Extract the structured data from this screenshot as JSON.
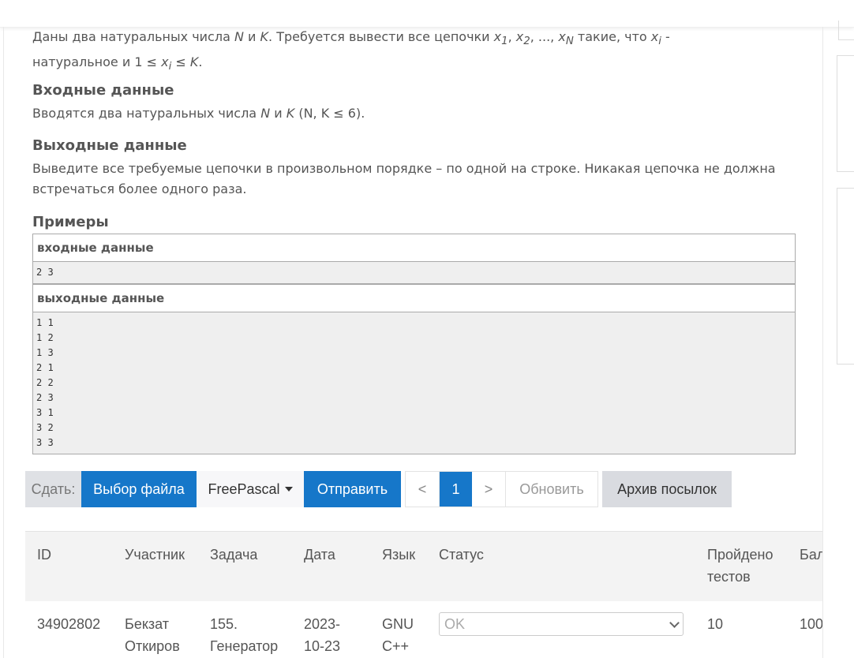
{
  "statement": {
    "line1_part1": "Даны два натуральных числа",
    "N": "N",
    "and": "и",
    "K": "K",
    "line1_part2": ". Требуется вывести  все цепочки",
    "chain": "x",
    "sub1": "1",
    "sub2": "2",
    "dots": "...,",
    "subN": "N",
    "line1_part3": "такие, что",
    "subi": "i",
    "dash": "-",
    "line2": "натуральное и 1 ≤",
    "leq": "≤"
  },
  "input_section": {
    "heading": "Входные данные",
    "text_part1": "Вводятся два натуральных числа",
    "text_part2": "(N, K ≤ 6)."
  },
  "output_section": {
    "heading": "Выходные данные",
    "text": "Выведите все требуемые цепочки в произвольном порядке – по одной на строке. Никакая цепочка не должна встречаться более одного раза."
  },
  "examples": {
    "heading": "Примеры",
    "input_title": "входные данные",
    "input_text": "2 3",
    "output_title": "выходные данные",
    "output_text": "1 1\n1 2\n1 3\n2 1\n2 2\n2 3\n3 1\n3 2\n3 3"
  },
  "toolbar": {
    "submit_label": "Сдать:",
    "choose_file": "Выбор файла",
    "language": "FreePascal",
    "send": "Отправить",
    "prev": "<",
    "page": "1",
    "next": ">",
    "refresh": "Обновить",
    "archive": "Архив посылок"
  },
  "table": {
    "headers": [
      "ID",
      "Участник",
      "Задача",
      "Дата",
      "Язык",
      "Статус",
      "Пройдено",
      "тестов",
      "Бал"
    ],
    "row": {
      "id": "34902802",
      "user_1": "Бекзат",
      "user_2": "Откиров",
      "problem_1": "155.",
      "problem_2": "Генератор",
      "date_1": "2023-",
      "date_2": "10-23",
      "lang_1": "GNU",
      "lang_2": "C++",
      "status": "OK",
      "tests": "10",
      "score": "100"
    }
  }
}
